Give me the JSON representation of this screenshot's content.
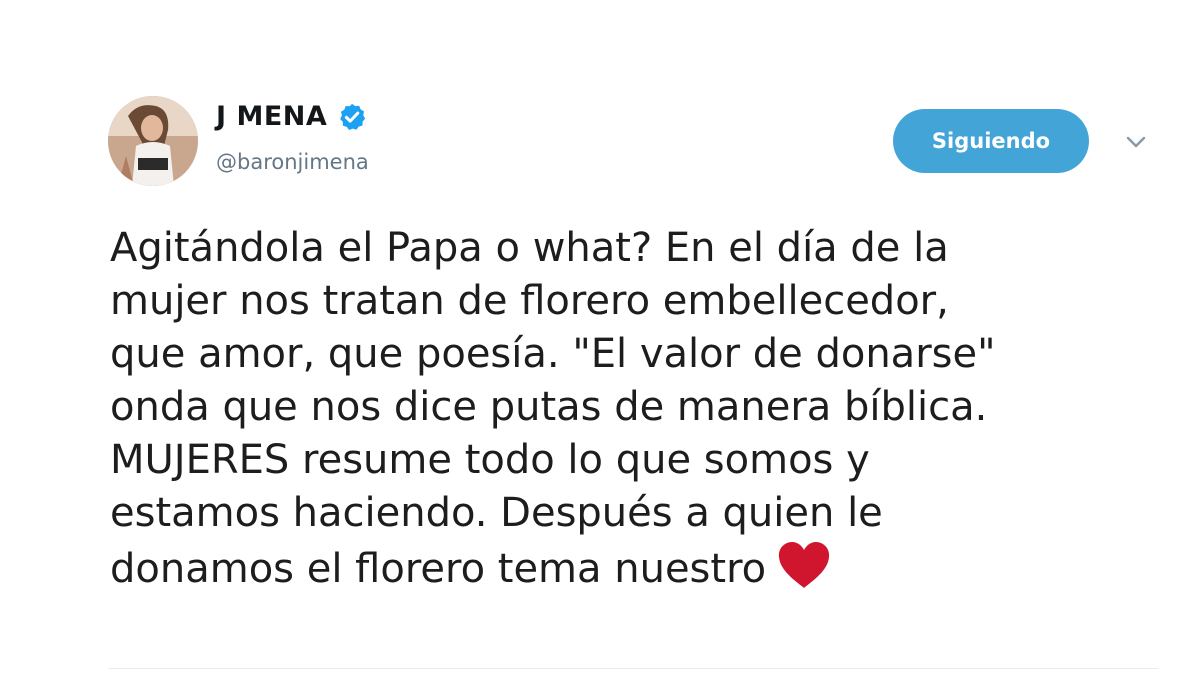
{
  "tweet": {
    "author": {
      "display_name": "J MENA",
      "handle": "@baronjimena",
      "verified": true,
      "avatar_icon": "profile-photo"
    },
    "follow_button_label": "Siguiendo",
    "menu_icon": "chevron-down-icon",
    "text_lines": [
      "Agitándola el Papa o what? En el día de la",
      "mujer nos tratan de florero embellecedor,",
      "que amor, que poesía. \"El valor de donarse\"",
      "onda que nos dice putas de manera bíblica.",
      "MUJERES resume todo lo que somos y",
      "estamos haciendo. Después a quien le",
      "donamos el florero tema nuestro"
    ],
    "emoji": "red-heart-icon"
  },
  "colors": {
    "accent": "#43a4d8",
    "verified": "#1da1f2",
    "heart": "#d0152f",
    "secondary_text": "#657786"
  }
}
